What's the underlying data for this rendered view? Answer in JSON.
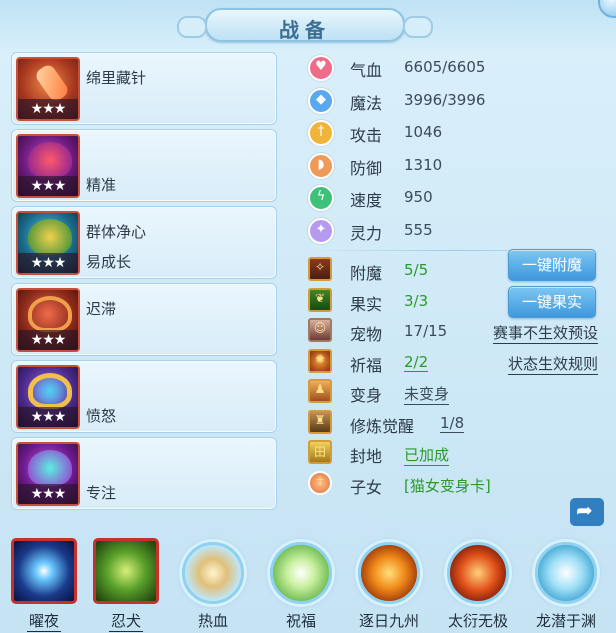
{
  "title": "战备",
  "cards": [
    {
      "name": "绵里藏针",
      "stars": "★★★",
      "icon": "ice-pole-icon"
    },
    {
      "name": "精准",
      "stars": "★★★",
      "icon": "purple-demon-icon"
    },
    {
      "name": "群体净心",
      "sub": "易成长",
      "stars": "★★★",
      "icon": "mask-totem-icon"
    },
    {
      "name": "迟滞",
      "stars": "★★★",
      "icon": "red-whip-icon"
    },
    {
      "name": "愤怒",
      "stars": "★★★",
      "icon": "crown-ring-icon"
    },
    {
      "name": "专注",
      "stars": "★★★",
      "icon": "violet-helmet-icon"
    }
  ],
  "stats": [
    {
      "label": "气血",
      "value": "6605/6605",
      "icon": "heart-icon",
      "color": "#ef6b8a"
    },
    {
      "label": "魔法",
      "value": "3996/3996",
      "icon": "mana-icon",
      "color": "#5aa9f0"
    },
    {
      "label": "攻击",
      "value": "1046",
      "icon": "sword-icon",
      "color": "#f1b43a"
    },
    {
      "label": "防御",
      "value": "1310",
      "icon": "shield-icon",
      "color": "#f09a5a"
    },
    {
      "label": "速度",
      "value": "950",
      "icon": "lightning-icon",
      "color": "#3ec27a"
    },
    {
      "label": "灵力",
      "value": "555",
      "icon": "spirit-icon",
      "color": "#b59af0"
    }
  ],
  "extras": {
    "enchant": {
      "label": "附魔",
      "value": "5/5"
    },
    "fruit": {
      "label": "果实",
      "value": "3/3"
    },
    "pet": {
      "label": "宠物",
      "value": "17/15"
    },
    "blessing": {
      "label": "祈福",
      "value": "2/2"
    },
    "transform": {
      "label": "变身",
      "value": "未变身"
    },
    "awaken": {
      "label": "修炼觉醒",
      "value": "1/8"
    },
    "territory": {
      "label": "封地",
      "value": "已加成"
    },
    "child": {
      "label": "子女",
      "value": "[猫女变身卡]"
    }
  },
  "buttons": {
    "enchant": "一键附魔",
    "fruit": "一键果实"
  },
  "links": {
    "event_preset": "赛事不生效预设",
    "state_rules": "状态生效规则"
  },
  "skills": [
    {
      "label": "曜夜",
      "icon": "starlight-icon",
      "style": "square"
    },
    {
      "label": "忍犬",
      "icon": "wolf-icon",
      "style": "square"
    },
    {
      "label": "热血",
      "icon": "warrior-icon",
      "style": "round"
    },
    {
      "label": "祝福",
      "icon": "blessing-icon",
      "style": "round"
    },
    {
      "label": "逐日九州",
      "icon": "sun-ring-icon",
      "style": "round"
    },
    {
      "label": "太衍无极",
      "icon": "drum-icon",
      "style": "round"
    },
    {
      "label": "龙潜于渊",
      "icon": "dragon-icon",
      "style": "round"
    }
  ],
  "colors": {
    "accent_green": "#2a9a2a",
    "button_blue": "#3f98dc",
    "title_text": "#3c6f93",
    "skill_selected_border": "#c8302a"
  }
}
